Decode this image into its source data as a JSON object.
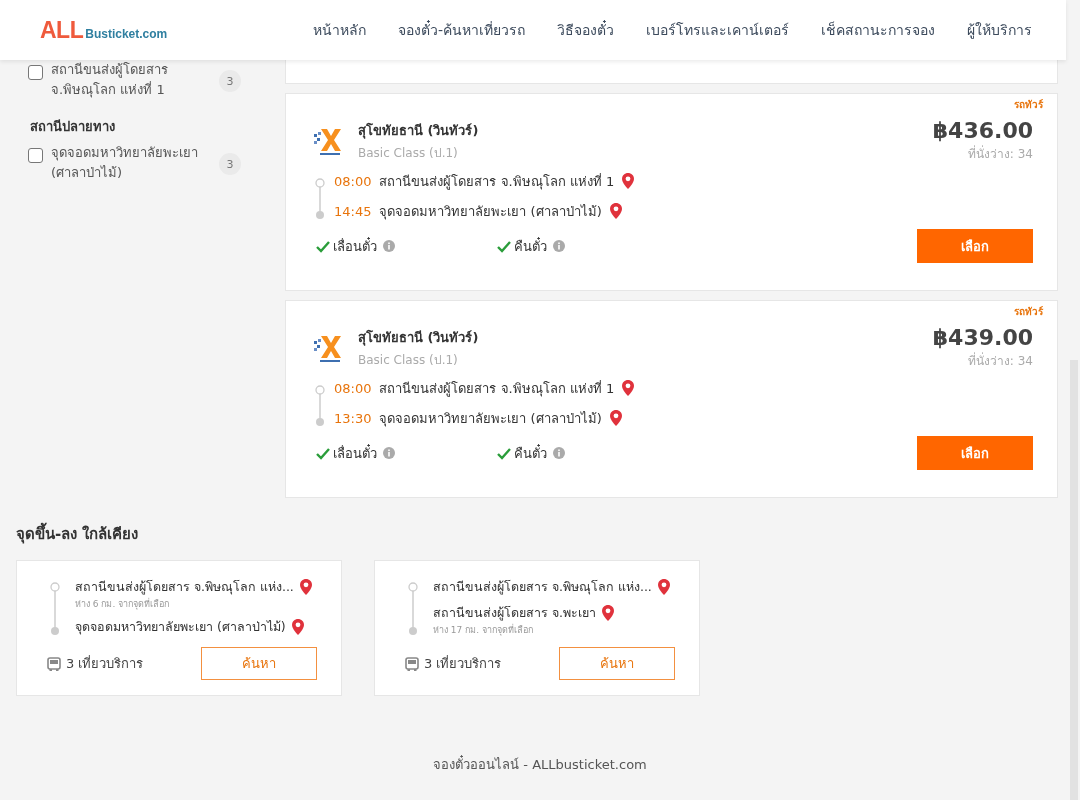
{
  "header": {
    "logo": {
      "main": "ALL",
      "sub": "Busticket.com"
    },
    "nav": [
      {
        "label": "หน้าหลัก"
      },
      {
        "label": "จองตั๋ว-ค้นหาเที่ยวรถ"
      },
      {
        "label": "วิธีจองตั๋ว"
      },
      {
        "label": "เบอร์โทรและเคาน์เตอร์"
      },
      {
        "label": "เช็คสถานะการจอง"
      },
      {
        "label": "ผู้ให้บริการ"
      }
    ]
  },
  "sidebar": {
    "groups": [
      {
        "items": [
          {
            "label": "สถานีขนส่งผู้โดยสาร จ.พิษณุโลก แห่งที่ 1",
            "count": "3",
            "checked": false
          }
        ]
      },
      {
        "title": "สถานีปลายทาง",
        "items": [
          {
            "label": "จุดจอดมหาวิทยาลัยพะเยา (ศาลาป่าไม้)",
            "count": "3",
            "checked": false
          }
        ]
      }
    ]
  },
  "trips": [
    {
      "tag": "รถทัวร์",
      "operator": "สุโขทัยธานี (วินทัวร์)",
      "class": "Basic Class (ป.1)",
      "price": "฿436.00",
      "seats": "ที่นั่งว่าง: 34",
      "stops": [
        {
          "time": "08:00",
          "place": "สถานีขนส่งผู้โดยสาร จ.พิษณุโลก แห่งที่ 1"
        },
        {
          "time": "14:45",
          "place": "จุดจอดมหาวิทยาลัยพะเยา (ศาลาป่าไม้)"
        }
      ],
      "features": [
        {
          "label": "เลื่อนตั๋ว",
          "available": true
        },
        {
          "label": "คืนตั๋ว",
          "available": true
        }
      ],
      "button": "เลือก"
    },
    {
      "tag": "รถทัวร์",
      "operator": "สุโขทัยธานี (วินทัวร์)",
      "class": "Basic Class (ป.1)",
      "price": "฿439.00",
      "seats": "ที่นั่งว่าง: 34",
      "stops": [
        {
          "time": "08:00",
          "place": "สถานีขนส่งผู้โดยสาร จ.พิษณุโลก แห่งที่ 1"
        },
        {
          "time": "13:30",
          "place": "จุดจอดมหาวิทยาลัยพะเยา (ศาลาป่าไม้)"
        }
      ],
      "features": [
        {
          "label": "เลื่อนตั๋ว",
          "available": true
        },
        {
          "label": "คืนตั๋ว",
          "available": true
        }
      ],
      "button": "เลือก"
    }
  ],
  "nearby": {
    "title": "จุดขึ้น-ลง ใกล้เคียง",
    "cards": [
      {
        "from": {
          "place": "สถานีขนส่งผู้โดยสาร จ.พิษณุโลก แห่ง...",
          "distance": "ห่าง 6 กม. จากจุดที่เลือก"
        },
        "to": {
          "place": "จุดจอดมหาวิทยาลัยพะเยา (ศาลาป่าไม้)"
        },
        "trips": "3 เที่ยวบริการ",
        "button": "ค้นหา"
      },
      {
        "from": {
          "place": "สถานีขนส่งผู้โดยสาร จ.พิษณุโลก แห่ง..."
        },
        "to": {
          "place": "สถานีขนส่งผู้โดยสาร จ.พะเยา",
          "distance": "ห่าง 17 กม. จากจุดที่เลือก"
        },
        "trips": "3 เที่ยวบริการ",
        "button": "ค้นหา"
      }
    ]
  },
  "footer": {
    "text": "จองตั๋วออนไลน์ - ALLbusticket.com"
  }
}
